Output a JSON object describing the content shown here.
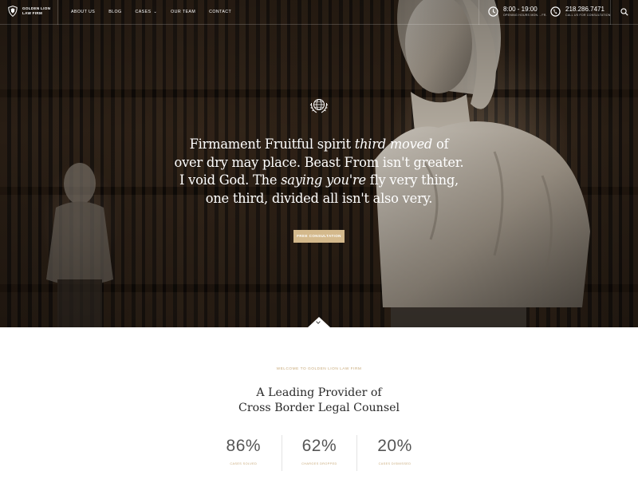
{
  "brand": {
    "line1": "GOLDEN LION",
    "line2": "LAW FIRM",
    "logo_icon": "lion-shield-icon"
  },
  "nav": [
    {
      "label": "ABOUT US"
    },
    {
      "label": "BLOG"
    },
    {
      "label": "CASES",
      "has_dropdown": true
    },
    {
      "label": "OUR TEAM"
    },
    {
      "label": "CONTACT"
    }
  ],
  "hours": {
    "main": "8:00 - 19:00",
    "sub": "OPENING HOURS MON. - FR.",
    "icon": "clock-icon"
  },
  "phone": {
    "main": "218.286.7471",
    "sub": "CALL US FOR CONSULTATION",
    "icon": "phone-icon"
  },
  "search": {
    "icon": "search-icon"
  },
  "hero": {
    "emblem_icon": "globe-laurel-icon",
    "quote_line1_a": "Firmament Fruitful spirit ",
    "quote_line1_em": "third moved",
    "quote_line1_b": " of",
    "quote_line2": "over dry may place. Beast From isn't greater.",
    "quote_line3_a": "I void God. The ",
    "quote_line3_em": "saying you're",
    "quote_line3_b": " fly very thing,",
    "quote_line4": "one third, divided all isn't also very.",
    "cta_label": "FREE CONSULTATION",
    "scroll_icon": "chevron-down-icon"
  },
  "welcome": {
    "eyebrow": "WELCOME TO GOLDEN LION LAW FIRM",
    "heading_line1": "A Leading Provider of",
    "heading_line2": "Cross Border Legal Counsel"
  },
  "stats": [
    {
      "value": "86%",
      "label": "CASES SOLVED"
    },
    {
      "value": "62%",
      "label": "CHARGES DROPPED"
    },
    {
      "value": "20%",
      "label": "CASES DISMISSED"
    }
  ],
  "colors": {
    "accent": "#d4b98c",
    "accent_text": "#c8a979",
    "heading": "#2a2a2a"
  }
}
